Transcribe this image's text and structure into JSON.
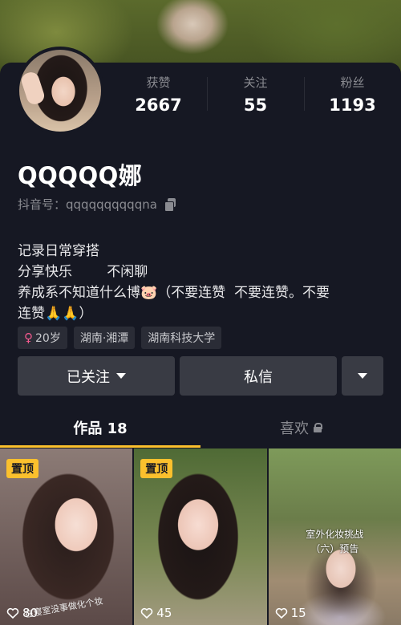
{
  "profile": {
    "username": "QQQQQ娜",
    "douyin_id": "抖音号：qqqqqqqqqqna",
    "stats": [
      {
        "label": "获赞",
        "value": "2667"
      },
      {
        "label": "关注",
        "value": "55"
      },
      {
        "label": "粉丝",
        "value": "1193"
      }
    ],
    "bio": [
      "记录日常穿搭",
      "分享快乐        不闲聊",
      "养成系不知道什么博🐷（不要连赞  不要连赞。不要",
      "连赞🙏🙏）"
    ],
    "tags": {
      "age": "20岁",
      "location": "湖南·湘潭",
      "school": "湖南科技大学"
    }
  },
  "actions": {
    "follow_label": "已关注",
    "message_label": "私信"
  },
  "tabs": {
    "works_label": "作品 18",
    "likes_label": "喜欢"
  },
  "videos": [
    {
      "pinned": "置顶",
      "likes": "80",
      "caption": "在寝室没事做化个妆"
    },
    {
      "pinned": "置顶",
      "likes": "45"
    },
    {
      "likes": "15",
      "overlay_line1": "室外化妆挑战",
      "overlay_line2": "（六）预告"
    }
  ],
  "colors": {
    "background": "#161823",
    "accent": "#fbc02d",
    "button": "#393b44",
    "female": "#f4598f"
  },
  "icons": [
    "copy-icon",
    "female-icon",
    "chevron-down-icon",
    "lock-icon",
    "heart-icon"
  ]
}
